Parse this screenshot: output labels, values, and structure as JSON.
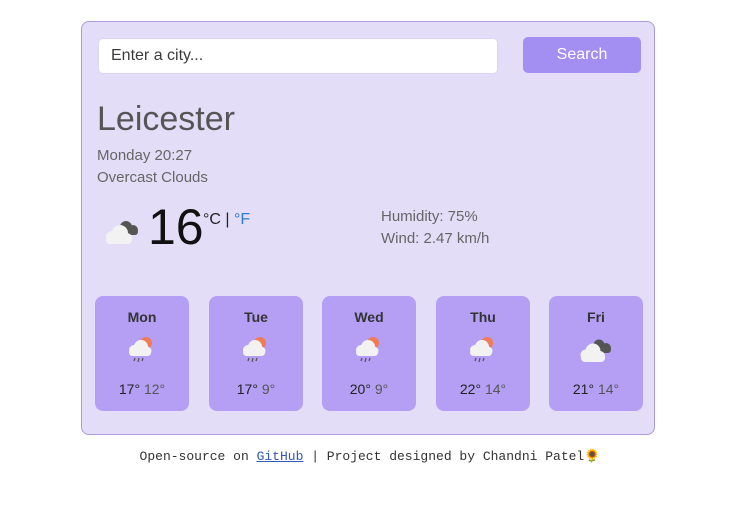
{
  "search": {
    "placeholder": "Enter a city...",
    "button_label": "Search"
  },
  "current": {
    "city": "Leicester",
    "datetime": "Monday 20:27",
    "description": "Overcast Clouds",
    "icon": "overcast-clouds-icon",
    "temperature": "16",
    "unit_c": "°C",
    "unit_separator": " | ",
    "unit_f": "°F",
    "humidity": "Humidity: 75%",
    "wind": "Wind: 2.47 km/h"
  },
  "forecast": [
    {
      "day": "Mon",
      "icon": "rain-icon",
      "max": "17°",
      "min": "12°"
    },
    {
      "day": "Tue",
      "icon": "rain-icon",
      "max": "17°",
      "min": "9°"
    },
    {
      "day": "Wed",
      "icon": "rain-icon",
      "max": "20°",
      "min": "9°"
    },
    {
      "day": "Thu",
      "icon": "rain-icon",
      "max": "22°",
      "min": "14°"
    },
    {
      "day": "Fri",
      "icon": "overcast-clouds-icon",
      "max": "21°",
      "min": "14°"
    }
  ],
  "footer": {
    "prefix": "Open-source on ",
    "link_label": "GitHub",
    "suffix": " | Project designed by Chandni Patel",
    "emoji": "🌻"
  },
  "colors": {
    "card_background": "#e3ddf7",
    "accent": "#a38ef2",
    "forecast_card": "#b59ff5",
    "link": "#2f7cd6"
  }
}
